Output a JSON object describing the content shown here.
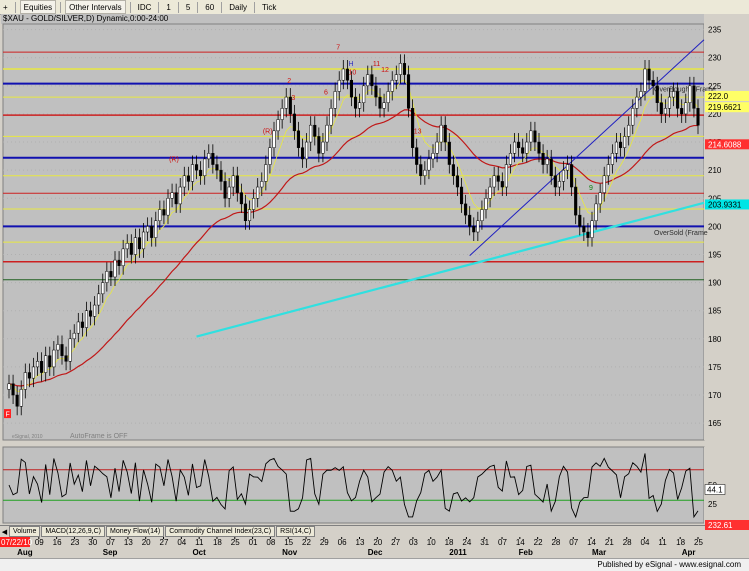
{
  "toolbar": {
    "items": [
      {
        "name": "plus-button",
        "label": "+",
        "kind": "icon"
      },
      {
        "name": "equities-dropdown",
        "label": "Equities",
        "kind": "box"
      },
      {
        "name": "other-intervals-dropdown",
        "label": "Other Intervals",
        "kind": "box"
      },
      {
        "name": "idc-button",
        "label": "IDC",
        "kind": "text"
      },
      {
        "name": "interval-1-button",
        "label": "1",
        "kind": "text"
      },
      {
        "name": "interval-5-button",
        "label": "5",
        "kind": "text"
      },
      {
        "name": "interval-60-button",
        "label": "60",
        "kind": "text"
      },
      {
        "name": "daily-button",
        "label": "Daily",
        "kind": "text"
      },
      {
        "name": "tick-button",
        "label": "Tick",
        "kind": "text"
      }
    ]
  },
  "chart_title": "$XAU - GOLD/SILVER,D) Dynamic,0:00-24:00",
  "footer": "Published by eSignal - www.esignal.com",
  "tabs": [
    "Volume",
    "MACD(12,26,9,C)",
    "Money Flow(14)",
    "Commodity Channel Index(23,C)",
    "RSI(14,C)"
  ],
  "watermark": "eSignal, 2010",
  "autoframe_text": "AutoFrame is OFF",
  "corner_marker": "F",
  "chart_data": {
    "type": "candlestick",
    "price_axis": {
      "ylim": [
        162,
        236
      ],
      "ticks": [
        165,
        170,
        175,
        180,
        185,
        190,
        195,
        200,
        205,
        210,
        215,
        220,
        225,
        230,
        235
      ]
    },
    "price_labels": [
      {
        "value": 223.2,
        "text": "222.0",
        "color": "#ffff66"
      },
      {
        "value": 221.2,
        "text": "219.6621",
        "color": "#ffff66"
      },
      {
        "value": 214.6,
        "text": "214.6088",
        "color": "#ff3030"
      },
      {
        "value": 203.9,
        "text": "203.9331",
        "color": "#00e5e5"
      }
    ],
    "x_months": [
      {
        "label": "Aug",
        "idx": 2
      },
      {
        "label": "Sep",
        "idx": 23
      },
      {
        "label": "Oct",
        "idx": 45
      },
      {
        "label": "Nov",
        "idx": 67
      },
      {
        "label": "Dec",
        "idx": 88
      },
      {
        "label": "2011",
        "idx": 108
      },
      {
        "label": "Feb",
        "idx": 125
      },
      {
        "label": "Mar",
        "idx": 143
      },
      {
        "label": "Apr",
        "idx": 165
      }
    ],
    "x_day_ticks": [
      "2",
      "09",
      "16",
      "23",
      "30",
      "07",
      "13",
      "20",
      "27",
      "04",
      "11",
      "18",
      "25",
      "01",
      "08",
      "15",
      "22",
      "29",
      "06",
      "13",
      "20",
      "27",
      "03",
      "10",
      "18",
      "24",
      "31",
      "07",
      "14",
      "22",
      "28",
      "07",
      "14",
      "21",
      "28",
      "04",
      "11",
      "18",
      "25"
    ],
    "x_first_date": "07/22/10",
    "horizontal_levels": [
      {
        "value": 231.0,
        "color": "#cc2020",
        "width": 1
      },
      {
        "value": 228.0,
        "color": "#e8e840",
        "width": 1.5
      },
      {
        "value": 225.4,
        "color": "#1010b0",
        "width": 2
      },
      {
        "value": 223.0,
        "color": "#e8e840",
        "width": 1
      },
      {
        "value": 219.8,
        "color": "#cc2020",
        "width": 1.5
      },
      {
        "value": 216.0,
        "color": "#e8e840",
        "width": 1
      },
      {
        "value": 212.2,
        "color": "#1010b0",
        "width": 2
      },
      {
        "value": 209.0,
        "color": "#e8e840",
        "width": 1
      },
      {
        "value": 205.9,
        "color": "#cc2020",
        "width": 1
      },
      {
        "value": 203.1,
        "color": "#e8e840",
        "width": 1
      },
      {
        "value": 200.0,
        "color": "#1010b0",
        "width": 2
      },
      {
        "value": 197.2,
        "color": "#e8e840",
        "width": 1
      },
      {
        "value": 193.7,
        "color": "#cc2020",
        "width": 1.5
      },
      {
        "value": 190.5,
        "color": "#206020",
        "width": 1
      }
    ],
    "level_notes": [
      {
        "text": "OverBought (Frame",
        "value": 224.5
      },
      {
        "text": "OverSold (Frame",
        "value": 199.0
      }
    ],
    "closes": [
      172,
      170,
      168,
      171,
      174,
      173,
      175,
      176,
      174,
      177,
      175,
      178,
      179,
      177,
      176,
      180,
      181,
      183,
      182,
      185,
      184,
      186,
      188,
      190,
      192,
      191,
      194,
      193,
      196,
      197,
      195,
      198,
      196,
      199,
      200,
      198,
      201,
      203,
      202,
      205,
      206,
      204,
      207,
      209,
      208,
      211,
      210,
      209,
      212,
      213,
      211,
      210,
      208,
      205,
      207,
      209,
      206,
      204,
      201,
      203,
      205,
      207,
      208,
      211,
      214,
      217,
      219,
      221,
      223,
      220,
      217,
      214,
      212,
      215,
      218,
      216,
      213,
      215,
      218,
      221,
      224,
      226,
      228,
      226,
      223,
      221,
      222,
      225,
      227,
      225,
      223,
      221,
      222,
      224,
      226,
      227,
      229,
      227,
      221,
      214,
      211,
      209,
      210,
      212,
      213,
      215,
      218,
      215,
      211,
      209,
      207,
      204,
      202,
      200,
      199,
      201,
      203,
      205,
      207,
      209,
      208,
      207,
      211,
      213,
      215,
      214,
      213,
      215,
      217,
      215,
      213,
      211,
      212,
      209,
      207,
      208,
      210,
      211,
      207,
      202,
      200,
      199,
      198,
      201,
      204,
      206,
      209,
      211,
      213,
      215,
      214,
      216,
      218,
      221,
      223,
      224,
      228,
      226,
      225,
      222,
      220,
      221,
      223,
      224,
      221,
      220,
      222,
      225,
      221,
      218
    ],
    "rsi": {
      "ylim": [
        0,
        100
      ],
      "overbought": 70,
      "oversold": 30,
      "last": 44.1,
      "ticks": [
        {
          "v": 0,
          "t": "0"
        },
        {
          "v": 25,
          "t": "25"
        },
        {
          "v": 44.1,
          "t": "44.1"
        },
        {
          "v": 50,
          "t": "50"
        }
      ],
      "bottom_label": "232.61"
    },
    "td_counts": [
      {
        "idx": 84,
        "text": "H",
        "color": "#3030c0"
      },
      {
        "idx": 84,
        "text": "10",
        "color": "#cc1010",
        "below": true
      },
      {
        "idx": 90,
        "text": "11",
        "color": "#cc1010"
      },
      {
        "idx": 92,
        "text": "12",
        "color": "#cc1010"
      },
      {
        "idx": 100,
        "text": "13",
        "color": "#cc1010"
      },
      {
        "idx": 69,
        "text": "2",
        "color": "#cc1010"
      },
      {
        "idx": 70,
        "text": "3",
        "color": "#cc1010"
      },
      {
        "idx": 78,
        "text": "6",
        "color": "#cc1010"
      },
      {
        "idx": 81,
        "text": "7",
        "color": "#cc1010"
      },
      {
        "idx": 63,
        "text": "(R)",
        "color": "#cc1010"
      },
      {
        "idx": 40,
        "text": "(R)",
        "color": "#cc1010"
      },
      {
        "idx": 143,
        "text": "9",
        "color": "#108010"
      }
    ]
  }
}
